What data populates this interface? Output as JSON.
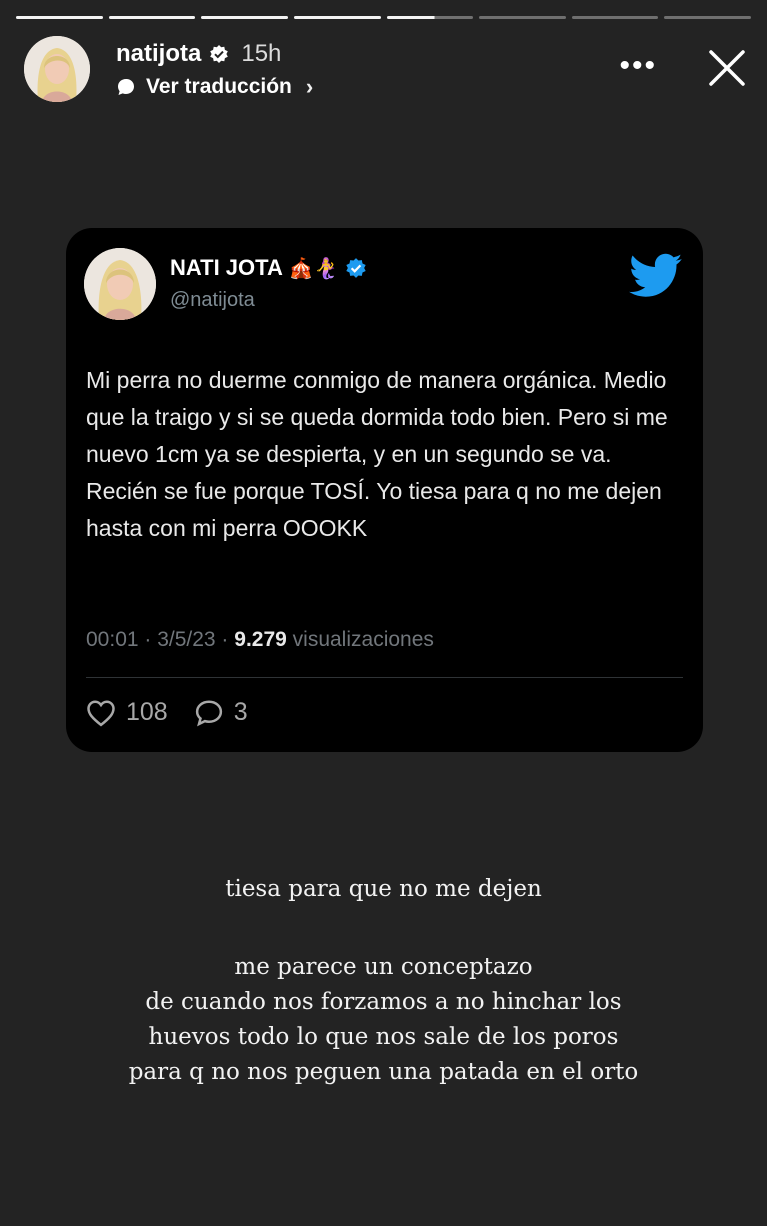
{
  "story": {
    "username": "natijota",
    "time": "15h",
    "translate_label": "Ver traducción",
    "more_label": "•••"
  },
  "tweet": {
    "display_name": "NATI JOTA",
    "name_emojis": "🎪🧜‍♀️",
    "handle": "@natijota",
    "text": "Mi perra no duerme conmigo de manera orgánica. Medio que la traigo y si se queda dormida todo bien. Pero si me nuevo 1cm ya se despierta, y en un segundo se va. Recién se fue porque TOSÍ. Yo tiesa para q no me dejen hasta con mi perra OOOKK",
    "timestamp": "00:01 · 3/5/23 · ",
    "views_count": "9.279",
    "views_label": " visualizaciones",
    "likes": "108",
    "replies": "3",
    "brand_color": "#1d9bf0"
  },
  "caption": {
    "line1": "tiesa para que no me dejen",
    "lines": [
      "me parece un conceptazo",
      "de cuando nos forzamos a no hinchar los",
      "huevos todo lo que nos sale de los poros",
      "para q no nos peguen una patada en el orto"
    ]
  }
}
